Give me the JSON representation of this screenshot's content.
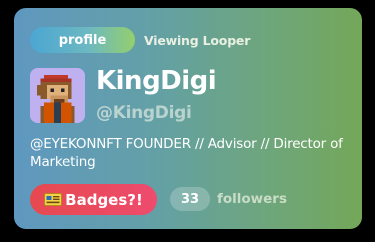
{
  "header": {
    "tab_label": "profile",
    "viewing_text": "Viewing Looper"
  },
  "profile": {
    "display_name": "KingDigi",
    "handle": "@KingDigi",
    "bio": "@EYEKONNFT FOUNDER // Advisor // Director of Marketing",
    "avatar_icon": "pixel-ape-avatar"
  },
  "actions": {
    "badges_label": "Badges?!",
    "badge_icon": "ticket-badge-icon"
  },
  "stats": {
    "followers_count": "33",
    "followers_label": "followers"
  },
  "colors": {
    "card_gradient_start": "#5f98c0",
    "card_gradient_end": "#74a759",
    "badges_button": "#e64a4f",
    "profile_tab": "#4ba6d2",
    "avatar_bg": "#bfb0f0"
  }
}
